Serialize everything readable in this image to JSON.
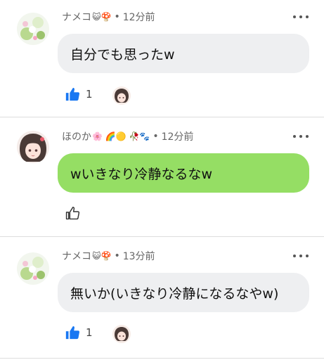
{
  "comments": [
    {
      "author": "ナメコ",
      "author_emojis": "😺🍄",
      "separator": "•",
      "time": "12分前",
      "text": "自分でも思ったw",
      "bubble_color": "#eeeff1",
      "like_count": "1",
      "liked": true,
      "avatar": "nameko-flower-avatar",
      "reactor_avatar": "honoka-avatar"
    },
    {
      "author": "ほのか",
      "author_emojis": "🌸 🌈🟡 🥀🐾",
      "separator": "•",
      "time": "12分前",
      "text": "wいきなり冷静なるなw",
      "bubble_color": "#95de64",
      "like_count": "",
      "liked": false,
      "avatar": "honoka-avatar",
      "reactor_avatar": ""
    },
    {
      "author": "ナメコ",
      "author_emojis": "😺🍄",
      "separator": "•",
      "time": "13分前",
      "text": "無いか(いきなり冷静になるなやw)",
      "bubble_color": "#eeeff1",
      "like_count": "1",
      "liked": true,
      "avatar": "nameko-flower-avatar",
      "reactor_avatar": "honoka-avatar"
    }
  ],
  "colors": {
    "like_blue": "#1877f2",
    "divider": "#dddddd"
  }
}
